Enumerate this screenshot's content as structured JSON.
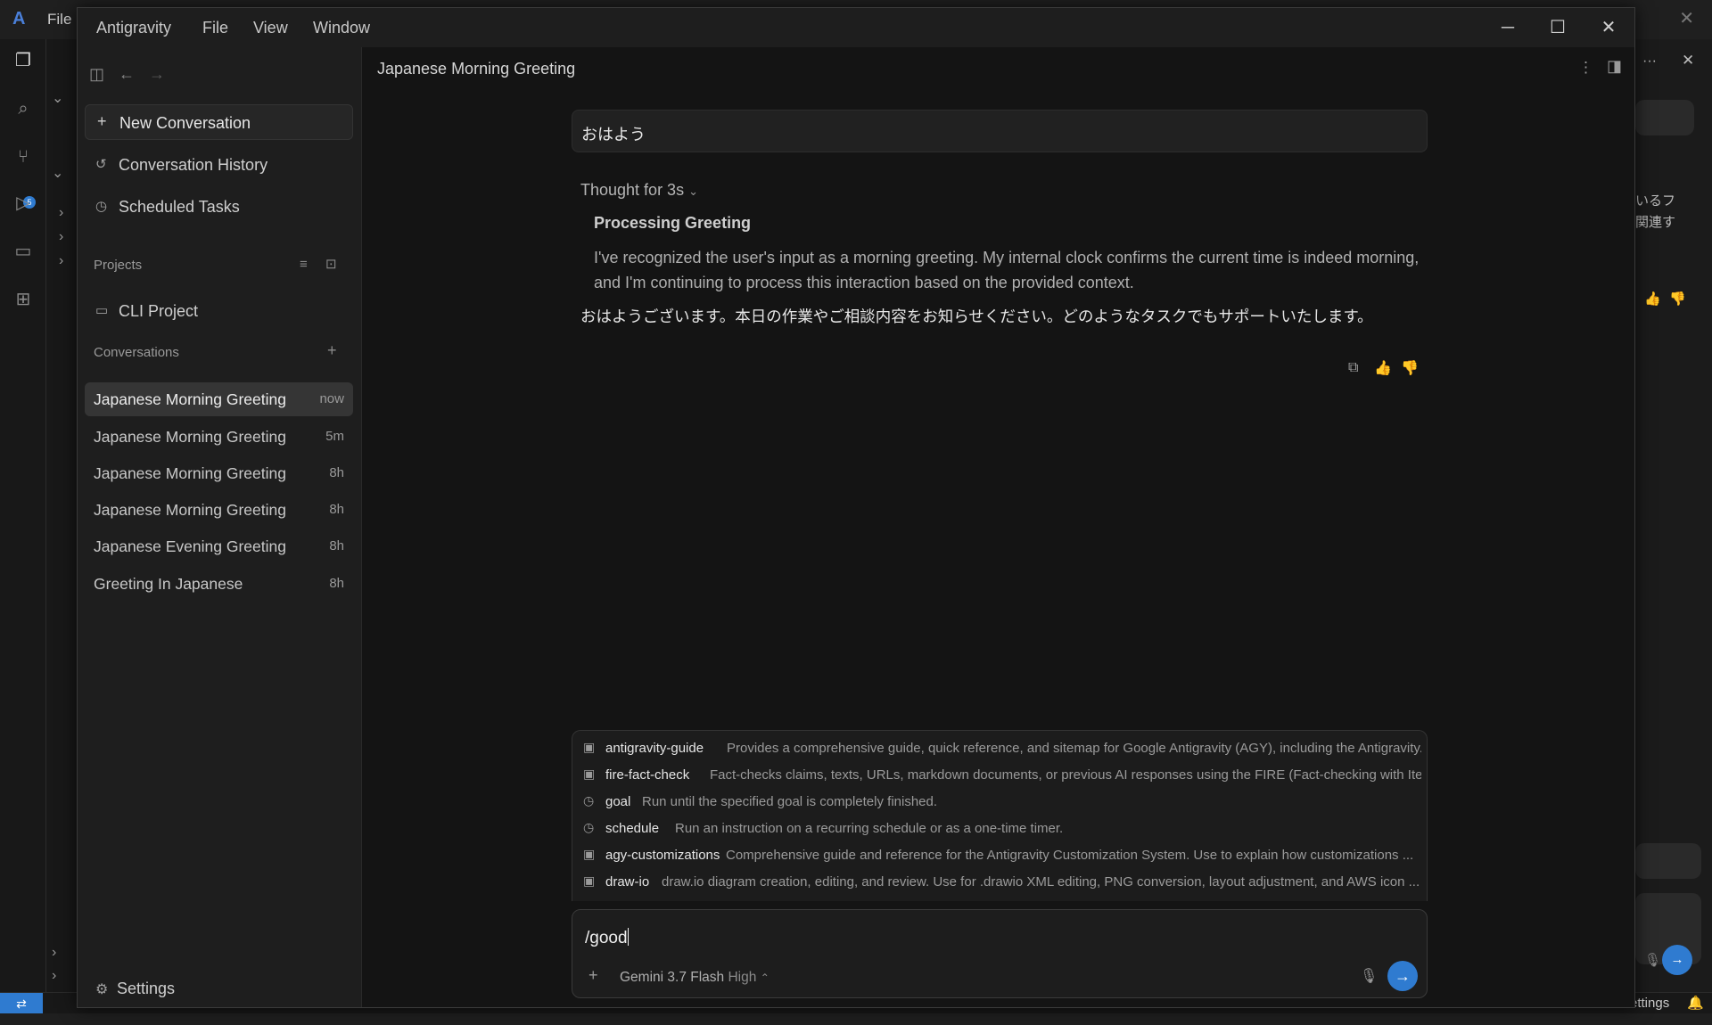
{
  "background": {
    "menu_file": "File",
    "right_snippet_1": "いるフ",
    "right_snippet_2": "関連す",
    "status_settings": "Settings",
    "scm_badge": "5"
  },
  "window": {
    "menus": [
      "Antigravity",
      "File",
      "View",
      "Window"
    ]
  },
  "sidebar": {
    "new_conversation": "New Conversation",
    "conversation_history": "Conversation History",
    "scheduled_tasks": "Scheduled Tasks",
    "projects_title": "Projects",
    "projects": [
      {
        "name": "CLI Project"
      }
    ],
    "conversations_title": "Conversations",
    "conversations": [
      {
        "title": "Japanese Morning Greeting",
        "time": "now"
      },
      {
        "title": "Japanese Morning Greeting",
        "time": "5m"
      },
      {
        "title": "Japanese Morning Greeting",
        "time": "8h"
      },
      {
        "title": "Japanese Morning Greeting",
        "time": "8h"
      },
      {
        "title": "Japanese Evening Greeting",
        "time": "8h"
      },
      {
        "title": "Greeting In Japanese",
        "time": "8h"
      }
    ],
    "settings": "Settings"
  },
  "chat": {
    "title": "Japanese Morning Greeting",
    "user_message": "おはよう",
    "thought_label": "Thought for 3s",
    "processing_title": "Processing Greeting",
    "processing_body": "I've recognized the user's input as a morning greeting. My internal clock confirms the current time is indeed morning, and I'm continuing to process this interaction based on the provided context.",
    "reply": "おはようございます。本日の作業やご相談内容をお知らせください。どのようなタスクでもサポートいたします。"
  },
  "suggestions": [
    {
      "name": "antigravity-guide",
      "description": "Provides a comprehensive guide, quick reference, and sitemap for Google Antigravity (AGY), including the Antigravity...",
      "icon": "skill-icon"
    },
    {
      "name": "fire-fact-check",
      "description": "Fact-checks claims, texts, URLs, markdown documents, or previous AI responses using the FIRE (Fact-checking with Iterat...",
      "icon": "skill-icon"
    },
    {
      "name": "goal",
      "description": "Run until the specified goal is completely finished.",
      "icon": "clock-icon"
    },
    {
      "name": "schedule",
      "description": "Run an instruction on a recurring schedule or as a one-time timer.",
      "icon": "clock-icon"
    },
    {
      "name": "agy-customizations",
      "description": "Comprehensive guide and reference for the Antigravity Customization System. Use to explain how customizations ...",
      "icon": "skill-icon"
    },
    {
      "name": "draw-io",
      "description": "draw.io diagram creation, editing, and review. Use for .drawio XML editing, PNG conversion, layout adjustment, and AWS icon ...",
      "icon": "skill-icon"
    }
  ],
  "input": {
    "value": "/good",
    "model": "Gemini 3.7 Flash",
    "level": "High"
  },
  "colors": {
    "accent": "#2f7bd0",
    "window_bg": "#141414",
    "panel_bg": "#1e1e1e"
  }
}
